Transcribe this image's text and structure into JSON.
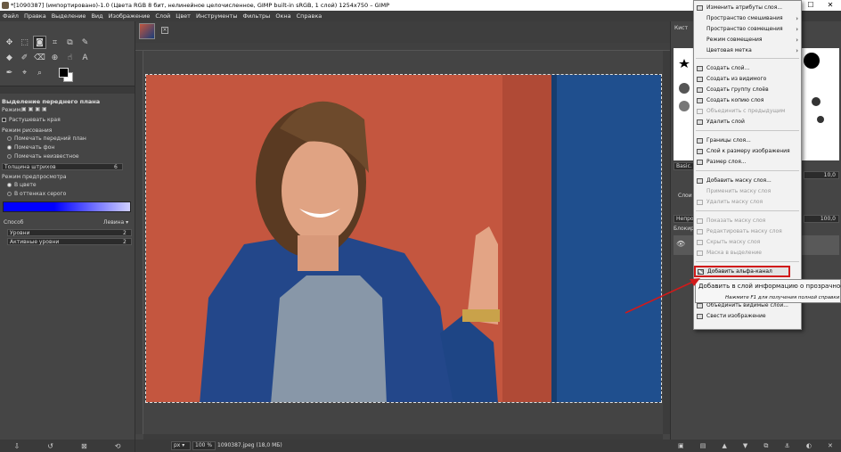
{
  "window": {
    "title": "*[1090387] (импортировано)-1.0 (Цвета RGB 8 бит, нелинейное целочисленное, GIMP built-in sRGB, 1 слой) 1254x750 – GIMP",
    "minimize": "—",
    "maximize": "☐",
    "close": "✕"
  },
  "menubar": [
    "Файл",
    "Правка",
    "Выделение",
    "Вид",
    "Изображение",
    "Слой",
    "Цвет",
    "Инструменты",
    "Фильтры",
    "Окна",
    "Справка"
  ],
  "toolbox": {
    "row1": [
      "move-icon",
      "rect-select-icon",
      "fuzzy-select-icon",
      "crop-icon",
      "unified-transform-icon",
      "warp-icon"
    ],
    "row2": [
      "bucket-fill-icon",
      "paintbrush-icon",
      "eraser-icon",
      "clone-icon",
      "smudge-icon",
      "text-icon"
    ],
    "row3": [
      "path-icon",
      "color-picker-icon",
      "zoom-icon"
    ]
  },
  "tool_options": {
    "title": "Выделение переднего плана",
    "mode_label": "Режим:",
    "grow_holes": "Растушевать края",
    "draw_mode_label": "Режим рисования",
    "draw_modes": [
      "Помечать передний план",
      "Помечать фон",
      "Помечать неизвестное"
    ],
    "stroke_width_label": "Толщина штрихов",
    "stroke_width_value": "6",
    "preview_mode_label": "Режим предпросмотра",
    "preview_modes": [
      "В цвете",
      "В оттенках серого"
    ],
    "engine_label": "Способ",
    "engine_value": "Левина",
    "levels_label": "Уровни",
    "levels_value": "2",
    "active_levels_label": "Активные уровни",
    "active_levels_value": "2"
  },
  "statusbar": {
    "unit": "px",
    "zoom": "100 %",
    "file": "1090387.jpeg (18,0 МБ)"
  },
  "right_dock": {
    "brushes_tab": "Кист",
    "brush_field": "Basic.",
    "spacing_value": "10,0",
    "layers_tab": "Слои",
    "mode_label": "Непроз",
    "opacity_value": "100,0",
    "lock_label": "Блокир"
  },
  "context_menu": {
    "items": [
      {
        "label": "Изменить атрибуты слоя...",
        "enabled": true,
        "submenu": false
      },
      {
        "label": "Пространство смешивания",
        "enabled": true,
        "submenu": true
      },
      {
        "label": "Пространство совмещения",
        "enabled": true,
        "submenu": true
      },
      {
        "label": "Режим совмещения",
        "enabled": true,
        "submenu": true
      },
      {
        "label": "Цветовая метка",
        "enabled": true,
        "submenu": true
      },
      {
        "label": "Создать слой...",
        "enabled": true,
        "submenu": false
      },
      {
        "label": "Создать из видимого",
        "enabled": true,
        "submenu": false
      },
      {
        "label": "Создать группу слоёв",
        "enabled": true,
        "submenu": false
      },
      {
        "label": "Создать копию слоя",
        "enabled": true,
        "submenu": false
      },
      {
        "label": "Объединить с предыдущим",
        "enabled": false,
        "submenu": false
      },
      {
        "label": "Удалить слой",
        "enabled": true,
        "submenu": false
      },
      {
        "label": "Границы слоя...",
        "enabled": true,
        "submenu": false
      },
      {
        "label": "Слой к размеру изображения",
        "enabled": true,
        "submenu": false
      },
      {
        "label": "Размер слоя...",
        "enabled": true,
        "submenu": false
      },
      {
        "label": "Добавить маску слоя...",
        "enabled": true,
        "submenu": false
      },
      {
        "label": "Применить маску слоя",
        "enabled": false,
        "submenu": false
      },
      {
        "label": "Удалить маску слоя",
        "enabled": false,
        "submenu": false
      },
      {
        "label": "Показать маску слоя",
        "enabled": false,
        "submenu": false
      },
      {
        "label": "Редактировать маску слоя",
        "enabled": false,
        "submenu": false
      },
      {
        "label": "Скрыть маску слоя",
        "enabled": false,
        "submenu": false
      },
      {
        "label": "Маска в выделение",
        "enabled": false,
        "submenu": false
      },
      {
        "label": "Добавить альфа-канал",
        "enabled": true,
        "submenu": false
      },
      {
        "label": "Объединить видимые слои...",
        "enabled": true,
        "submenu": false
      },
      {
        "label": "Свести изображение",
        "enabled": true,
        "submenu": false
      }
    ],
    "highlighted": "Добавить альфа-канал",
    "tooltip_text": "Добавить в слой информацию о прозрачности",
    "tooltip_hint": "Нажмите F1 для получения полной справки"
  },
  "colors": {
    "highlight_border": "#d11a1a",
    "arrow": "#d11a1a"
  }
}
